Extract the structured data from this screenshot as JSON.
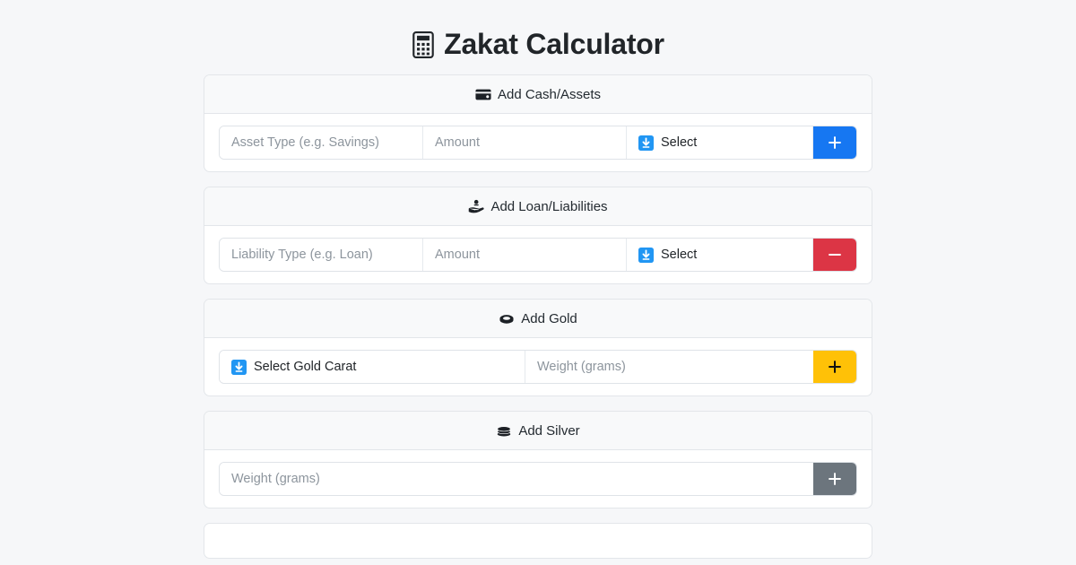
{
  "header": {
    "title": "Zakat Calculator",
    "title_icon": "calculator-icon"
  },
  "colors": {
    "page_background": "#f6f7f9",
    "card_background": "#ffffff",
    "card_header_background": "#f8f9fa",
    "card_border": "#e3e6ea",
    "add_button_blue": "#1677f2",
    "remove_button_red": "#dc3545",
    "gold_button_amber": "#ffc107",
    "silver_button_gray": "#6c757d",
    "select_icon_blue": "#2196f3",
    "placeholder_text": "#8d959d",
    "body_text": "#212529"
  },
  "cards": [
    {
      "id": "cash-assets",
      "header_label": "Add Cash/Assets",
      "header_icon": "wallet-icon",
      "fields": [
        {
          "name": "asset-type-input",
          "placeholder": "Asset Type (e.g. Savings)",
          "value": ""
        },
        {
          "name": "asset-amount-input",
          "placeholder": "Amount",
          "value": ""
        }
      ],
      "select": {
        "name": "asset-currency-select",
        "label": "Select",
        "icon": "download-select-icon"
      },
      "button": {
        "name": "add-asset-button",
        "glyph": "+",
        "color": "#1677f2",
        "glyph_color": "#ffffff"
      }
    },
    {
      "id": "loan-liabilities",
      "header_label": "Add Loan/Liabilities",
      "header_icon": "hand-holding-money-icon",
      "fields": [
        {
          "name": "liability-type-input",
          "placeholder": "Liability Type (e.g. Loan)",
          "value": ""
        },
        {
          "name": "liability-amount-input",
          "placeholder": "Amount",
          "value": ""
        }
      ],
      "select": {
        "name": "liability-currency-select",
        "label": "Select",
        "icon": "download-select-icon"
      },
      "button": {
        "name": "remove-liability-button",
        "glyph": "−",
        "color": "#dc3545",
        "glyph_color": "#ffffff"
      }
    },
    {
      "id": "gold",
      "header_label": "Add Gold",
      "header_icon": "ring-icon",
      "select": {
        "name": "gold-carat-select",
        "label": "Select Gold Carat",
        "icon": "download-select-icon"
      },
      "fields": [
        {
          "name": "gold-weight-input",
          "placeholder": "Weight (grams)",
          "value": ""
        }
      ],
      "button": {
        "name": "add-gold-button",
        "glyph": "+",
        "color": "#ffc107",
        "glyph_color": "#111111"
      }
    },
    {
      "id": "silver",
      "header_label": "Add Silver",
      "header_icon": "coins-stack-icon",
      "fields": [
        {
          "name": "silver-weight-input",
          "placeholder": "Weight (grams)",
          "value": ""
        }
      ],
      "button": {
        "name": "add-silver-button",
        "glyph": "+",
        "color": "#6c757d",
        "glyph_color": "#ffffff"
      }
    }
  ]
}
